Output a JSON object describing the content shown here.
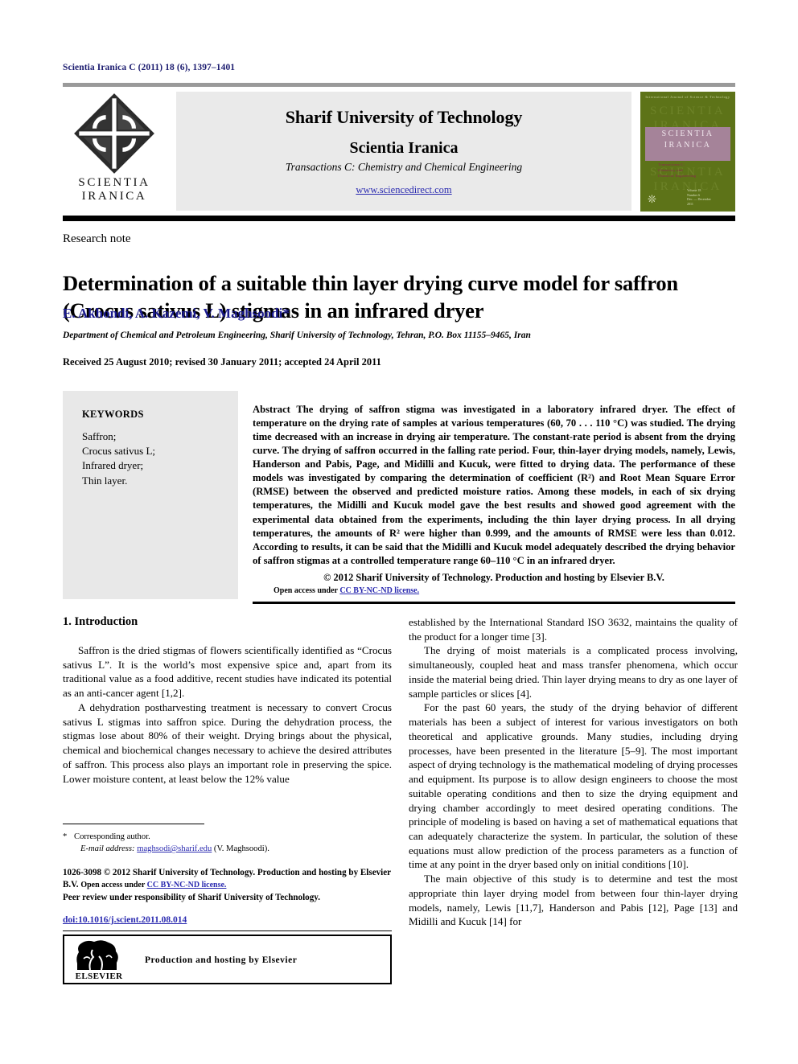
{
  "running_head": "Scientia Iranica C (2011) 18 (6), 1397–1401",
  "masthead": {
    "logo_line1": "SCIENTIA",
    "logo_line2": "IRANICA",
    "university": "Sharif University of Technology",
    "journal": "Scientia Iranica",
    "transactions": "Transactions C: Chemistry and Chemical Engineering",
    "url": "www.sciencedirect.com",
    "cover": {
      "top_line": "International Journal of Science & Technology",
      "ghost_lines": [
        "SCIENTIA",
        "IRANICA",
        "SCIENTIA",
        "IRANICA",
        "SCIENTIA",
        "IRANICA"
      ],
      "band_line1": "SCIENTIA",
      "band_line2": "IRANICA",
      "subtitle_lines": [
        "Transactions C:",
        "Chemistry and",
        "Chemical Engineering"
      ],
      "footer_lines": [
        "Volume 18",
        "Number 6",
        "Dec. — December",
        "2011"
      ],
      "bg_color": "#5d7318",
      "band_color": "#a58399"
    }
  },
  "article": {
    "type": "Research note",
    "title": "Determination of a suitable thin layer drying curve model for saffron (Crocus sativus L) stigmas in an infrared dryer",
    "authors": "E. Akhondi, A. Kazemi, V. Maghsoodi*",
    "affiliation": "Department of Chemical and Petroleum Engineering, Sharif University of Technology, Tehran, P.O. Box 11155–9465, Iran",
    "dates": "Received 25 August 2010; revised 30 January 2011; accepted 24 April 2011",
    "author_color": "#1b1b8f"
  },
  "keywords": {
    "title": "KEYWORDS",
    "items": [
      "Saffron;",
      "Crocus sativus L;",
      "Infrared dryer;",
      "Thin layer."
    ]
  },
  "abstract": {
    "label": "Abstract",
    "text": "The drying of saffron stigma was investigated in a laboratory infrared dryer. The effect of temperature on the drying rate of samples at various temperatures (60, 70 . . . 110 °C) was studied. The drying time decreased with an increase in drying air temperature. The constant-rate period is absent from the drying curve. The drying of saffron occurred in the falling rate period. Four, thin-layer drying models, namely, Lewis, Handerson and Pabis, Page, and Midilli and Kucuk, were fitted to drying data. The performance of these models was investigated by comparing the determination of coefficient (R²) and Root Mean Square Error (RMSE) between the observed and predicted moisture ratios. Among these models, in each of six drying temperatures, the Midilli and Kucuk model gave the best results and showed good agreement with the experimental data obtained from the experiments, including the thin layer drying process. In all drying temperatures, the amounts of R² were higher than 0.999, and the amounts of RMSE were less than 0.012. According to results, it can be said that the Midilli and Kucuk model adequately described the drying behavior of saffron stigmas at a controlled temperature range 60–110 °C in an infrared dryer.",
    "copyright": "© 2012 Sharif University of Technology. Production and hosting by Elsevier B.V.",
    "open_access_prefix": "Open access under ",
    "open_access_link": "CC BY-NC-ND license."
  },
  "body": {
    "section_heading": "1.  Introduction",
    "left_paragraphs": [
      "Saffron is the dried stigmas of flowers scientifically identified as “Crocus sativus L”. It is the world’s most expensive spice and, apart from its traditional value as a food additive, recent studies have indicated its potential as an anti-cancer agent [1,2].",
      "A dehydration postharvesting treatment is necessary to convert Crocus sativus L stigmas into saffron spice. During the dehydration process, the stigmas lose about 80% of their weight. Drying brings about the physical, chemical and biochemical changes necessary to achieve the desired attributes of saffron. This process also plays an important role in preserving the spice. Lower moisture content, at least below the 12% value"
    ],
    "right_paragraphs": [
      "established by the International Standard ISO 3632, maintains the quality of the product for a longer time [3].",
      "The drying of moist materials is a complicated process involving, simultaneously, coupled heat and mass transfer phenomena, which occur inside the material being dried. Thin layer drying means to dry as one layer of sample particles or slices [4].",
      "For the past 60 years, the study of the drying behavior of different materials has been a subject of interest for various investigators on both theoretical and applicative grounds. Many studies, including drying processes, have been presented in the literature [5–9]. The most important aspect of drying technology is the mathematical modeling of drying processes and equipment. Its purpose is to allow design engineers to choose the most suitable operating conditions and then to size the drying equipment and drying chamber accordingly to meet desired operating conditions. The principle of modeling is based on having a set of mathematical equations that can adequately characterize the system. In particular, the solution of these equations must allow prediction of the process parameters as a function of time at any point in the dryer based only on initial conditions [10].",
      "The main objective of this study is to determine and test the most appropriate thin layer drying model from between four thin-layer drying models, namely, Lewis [11,7], Handerson and Pabis [12], Page [13] and Midilli and Kucuk [14] for"
    ]
  },
  "footnotes": {
    "corresponding": "Corresponding author.",
    "email_label": "E-mail address:",
    "email": "maghsodi@sharif.edu",
    "email_suffix": "(V. Maghsoodi).",
    "imprint_line1": "1026-3098 © 2012 Sharif University of Technology. Production and hosting by Elsevier B.V.",
    "imprint_oa_prefix": "Open access under ",
    "imprint_oa_link": "CC BY-NC-ND license.",
    "peer_review": "Peer review under responsibility of Sharif  University of Technology.",
    "doi": "doi:10.1016/j.scient.2011.08.014",
    "elsevier_word": "ELSEVIER",
    "production_text": "Production and hosting by Elsevier"
  }
}
